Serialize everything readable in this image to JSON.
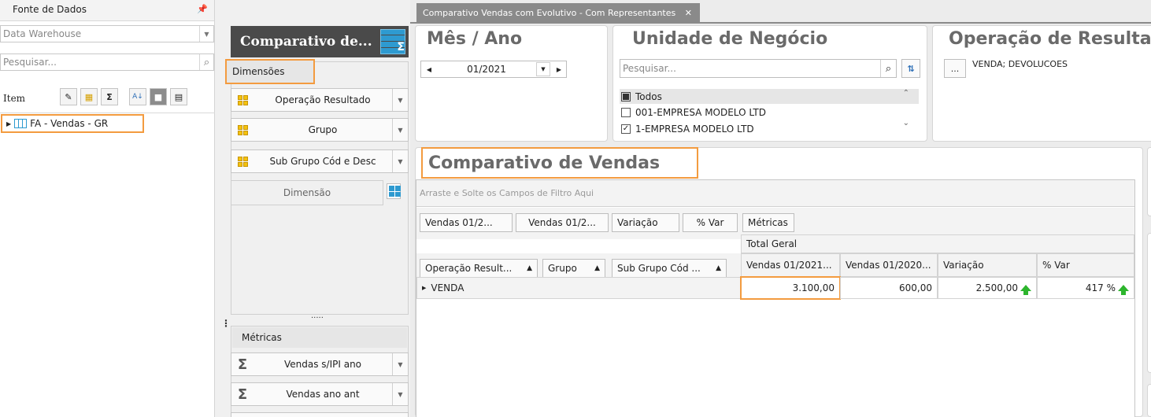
{
  "left": {
    "header": "Fonte de Dados",
    "source_value": "Data Warehouse",
    "search_placeholder": "Pesquisar...",
    "toolbar_label": "Item",
    "tree_item": "FA - Vendas - GR"
  },
  "middle": {
    "title": "Comparativo de...",
    "dimensions_label": "Dimensões",
    "dimensions": [
      "Operação Resultado",
      "Grupo",
      "Sub Grupo Cód e Desc"
    ],
    "dimension_placeholder": "Dimensão",
    "splitter": ".....",
    "metrics_label": "Métricas",
    "metrics": [
      "Vendas s/IPI ano",
      "Vendas ano ant"
    ]
  },
  "tab": {
    "label": "Comparativo Vendas com Evolutivo - Com Representantes",
    "close": "✕"
  },
  "filters": {
    "month": {
      "title": "Mês / Ano",
      "value": "01/2021"
    },
    "unit": {
      "title": "Unidade de Negócio",
      "search_placeholder": "Pesquisar...",
      "items": [
        {
          "label": "Todos",
          "state": "partial"
        },
        {
          "label": "001-EMPRESA MODELO LTD",
          "state": "unchecked"
        },
        {
          "label": "1-EMPRESA MODELO LTD",
          "state": "checked"
        }
      ]
    },
    "operation": {
      "title": "Operação de Resulta",
      "button": "...",
      "value": "VENDA; DEVOLUCOES"
    }
  },
  "pivot": {
    "title": "Comparativo de Vendas",
    "filter_area": "Arraste e Solte os Campos de Filtro Aqui",
    "data_fields": [
      "Vendas 01/2...",
      "Vendas 01/2...",
      "Variação",
      "% Var"
    ],
    "metrics_button": "Métricas",
    "total_label": "Total Geral",
    "row_fields": [
      "Operação Result...",
      "Grupo",
      "Sub Grupo Cód ..."
    ],
    "column_headers": [
      "Vendas 01/2021...",
      "Vendas 01/2020...",
      "Variação",
      "% Var"
    ],
    "rows": [
      {
        "label": "VENDA",
        "values": [
          "3.100,00",
          "600,00",
          "2.500,00",
          "417 %"
        ]
      }
    ]
  },
  "colors": {
    "highlight": "#f39b3f",
    "title_bar": "#4a4a4a",
    "accent_blue": "#2e9ad0",
    "arrow_green": "#2db52d"
  }
}
